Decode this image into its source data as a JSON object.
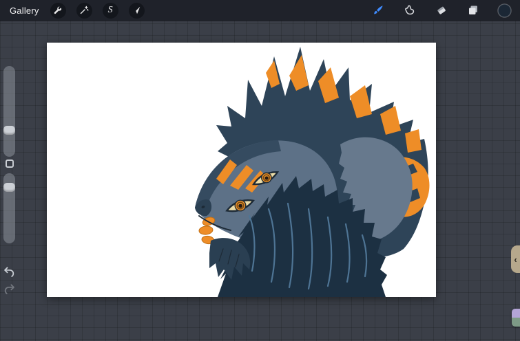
{
  "topbar": {
    "gallery_label": "Gallery",
    "selection_glyph": "S",
    "left_tool_icons": [
      "wrench-icon",
      "magic-wand-icon",
      "selection-s-icon",
      "transform-arrow-icon"
    ],
    "right_tool_icons": [
      "paintbrush-icon",
      "smudge-finger-icon",
      "eraser-icon",
      "layers-icon",
      "color-circle-icon"
    ],
    "colors": {
      "bar": "#1f222a",
      "icon_circle": "#13161c",
      "glyph": "#e9e9ea",
      "active_brush": "#3f8cff",
      "current_color": "#1b2735"
    }
  },
  "left_sidebar": {
    "slider_icons": [
      "brush-size-slider",
      "opacity-slider"
    ],
    "undo_icon": "undo-arrow-icon",
    "redo_icon": "redo-arrow-icon"
  },
  "right_edge": {
    "pull_tab": {
      "chevron": "‹",
      "color": "#b6a88c"
    },
    "mini_tab": {
      "colors": [
        "#b3a4d6",
        "#7d9a86"
      ]
    }
  },
  "canvas": {
    "background": "#ffffff"
  },
  "artwork": {
    "subject": "dragon-wolf creature head with dark slate mane, orange stripes and amber eyes",
    "palette": {
      "mane": "#2e4458",
      "face": "#5d7187",
      "muzzle_shadow": "#354b60",
      "chest": "#67798d",
      "fur_navy": "#1c3042",
      "fur_streak": "#4e7494",
      "orange": "#ee8d27",
      "orange_deep": "#c06f15",
      "eye_cream": "#ecdca6",
      "eye_iris": "#e8912b",
      "eye_ring": "#7a4a12",
      "pupil": "#241a12",
      "outline": "#1d2a36",
      "beard": "#2a3f52",
      "nose": "#2b4053"
    }
  }
}
